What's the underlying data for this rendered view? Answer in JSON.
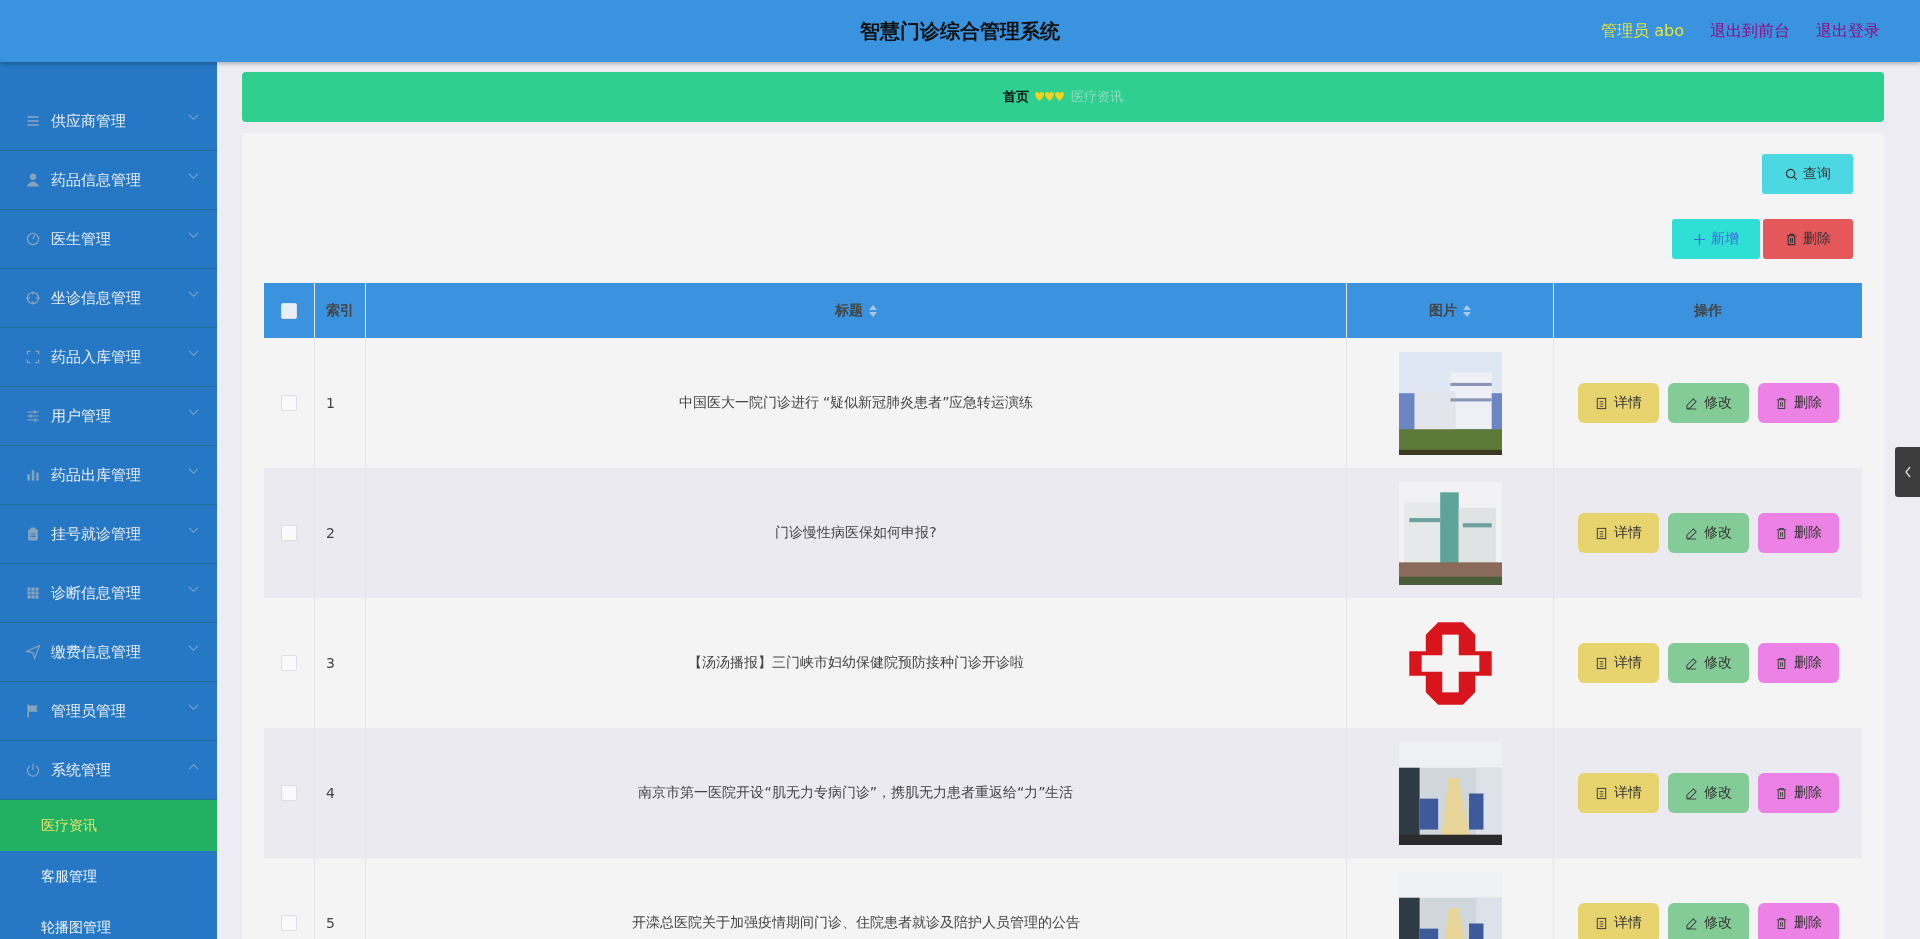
{
  "header": {
    "title": "智慧门诊综合管理系统",
    "user": "管理员 abo",
    "links": [
      "退出到前台",
      "退出登录"
    ]
  },
  "sidebar": {
    "items": [
      {
        "label": "供应商管理",
        "expanded": false
      },
      {
        "label": "药品信息管理",
        "expanded": false
      },
      {
        "label": "医生管理",
        "expanded": false
      },
      {
        "label": "坐诊信息管理",
        "expanded": false
      },
      {
        "label": "药品入库管理",
        "expanded": false
      },
      {
        "label": "用户管理",
        "expanded": false
      },
      {
        "label": "药品出库管理",
        "expanded": false
      },
      {
        "label": "挂号就诊管理",
        "expanded": false
      },
      {
        "label": "诊断信息管理",
        "expanded": false
      },
      {
        "label": "缴费信息管理",
        "expanded": false
      },
      {
        "label": "管理员管理",
        "expanded": false
      },
      {
        "label": "系统管理",
        "expanded": true,
        "children": [
          {
            "label": "医疗资讯",
            "selected": true
          },
          {
            "label": "客服管理",
            "selected": false
          },
          {
            "label": "轮播图管理",
            "selected": false
          }
        ]
      }
    ]
  },
  "breadcrumb": {
    "home": "首页",
    "current": "医疗资讯"
  },
  "toolbar": {
    "search_button": "查询",
    "add_button": "新增",
    "delete_button": "删除"
  },
  "table": {
    "select_all": {
      "checked": false
    },
    "columns": [
      {
        "label": "索引",
        "sortable": false
      },
      {
        "label": "标题",
        "sortable": true
      },
      {
        "label": "图片",
        "sortable": true
      },
      {
        "label": "操作",
        "sortable": false
      }
    ],
    "rows": [
      {
        "checked": false,
        "index": "1",
        "title": "中国医大一院门诊进行 “疑似新冠肺炎患者”应急转运演练",
        "image": {
          "kind": "picture"
        },
        "actions": [
          "详情",
          "修改",
          "删除"
        ]
      },
      {
        "checked": false,
        "index": "2",
        "title": "门诊慢性病医保如何申报?",
        "image": {
          "kind": "picture"
        },
        "actions": [
          "详情",
          "修改",
          "删除"
        ]
      },
      {
        "checked": false,
        "index": "3",
        "title": "【汤汤播报】三门峡市妇幼保健院预防接种门诊开诊啦",
        "image": {
          "kind": "picture"
        },
        "actions": [
          "详情",
          "修改",
          "删除"
        ]
      },
      {
        "checked": false,
        "index": "4",
        "title": "南京市第一医院开设“肌无力专病门诊”，携肌无力患者重返给“力”生活",
        "image": {
          "kind": "picture"
        },
        "actions": [
          "详情",
          "修改",
          "删除"
        ]
      },
      {
        "checked": false,
        "index": "5",
        "title": "开滦总医院关于加强疫情期间门诊、住院患者就诊及陪护人员管理的公告",
        "image": {
          "kind": "picture"
        },
        "actions": [
          "详情",
          "修改",
          "删除"
        ]
      }
    ]
  }
}
